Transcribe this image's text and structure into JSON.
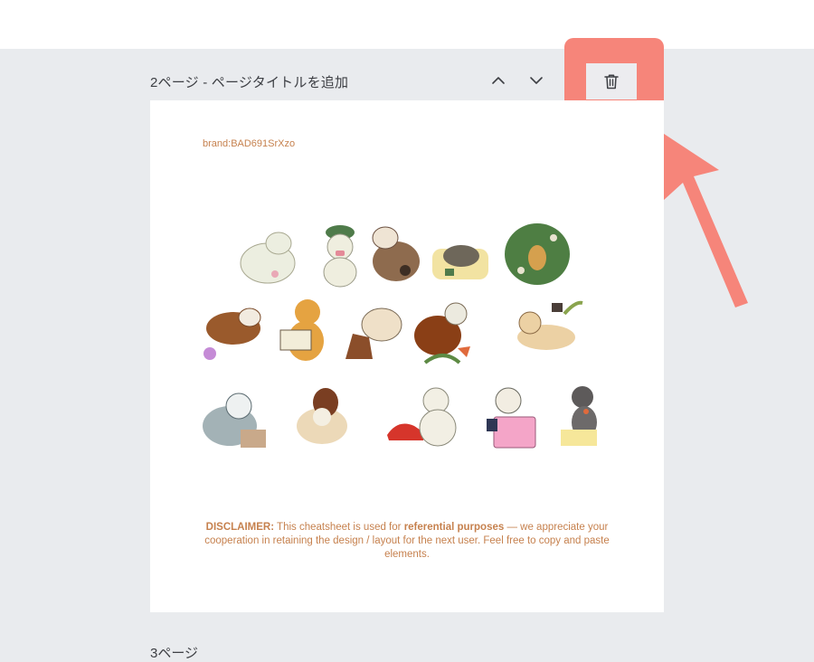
{
  "page": {
    "title": "2ページ - ページタイトルを追加",
    "next_page_title": "3ページ"
  },
  "controls": {
    "move_up_icon": "chevron-up-icon",
    "move_down_icon": "chevron-down-icon",
    "delete_icon": "trash-icon"
  },
  "highlight_color": "#f6857a",
  "canvas": {
    "brand_tag": "brand:BAD691SrXzo",
    "disclaimer": {
      "label": "DISCLAIMER:",
      "text1": " This cheatsheet is used for ",
      "emphasis": "referential purposes",
      "text2": " — we appreciate your cooperation in retaining the design / layout for the next user. Feel free to copy and paste elements."
    },
    "text_color": "#c6814e"
  }
}
